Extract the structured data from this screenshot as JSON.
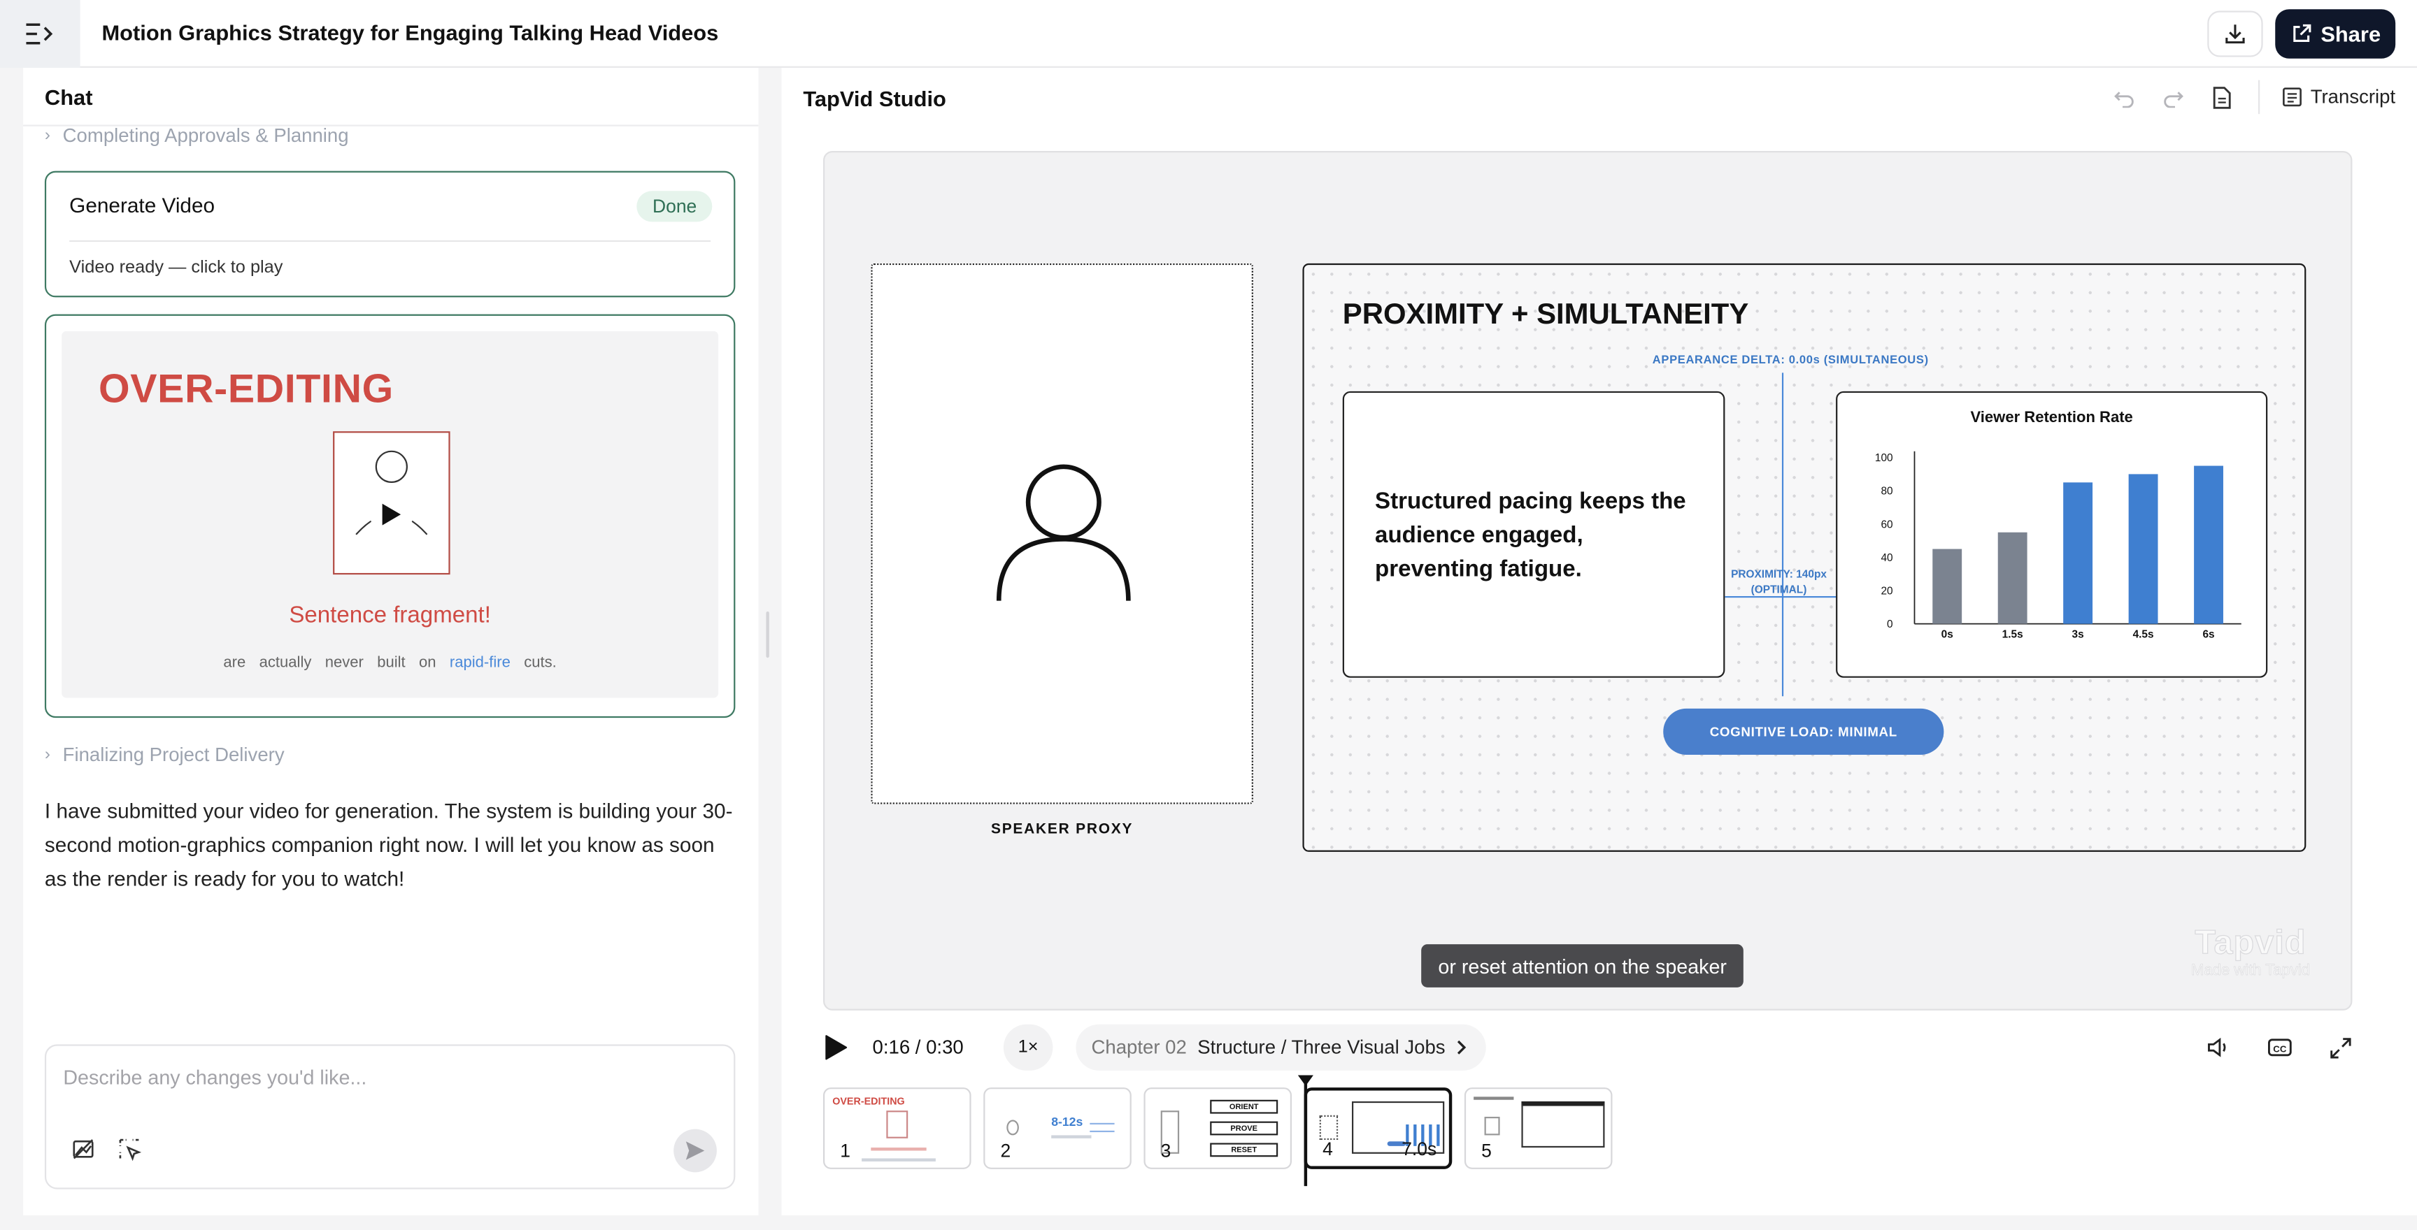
{
  "header": {
    "title": "Motion Graphics Strategy for Engaging Talking Head Videos",
    "share_label": "Share"
  },
  "chat": {
    "title": "Chat",
    "steps": [
      {
        "label": "Completing Approvals & Planning"
      },
      {
        "label": "Finalizing Project Delivery"
      }
    ],
    "generate_card": {
      "title": "Generate Video",
      "status": "Done",
      "subtitle": "Video ready — click to play"
    },
    "preview": {
      "headline": "OVER-EDITING",
      "fragment_label": "Sentence fragment!",
      "words": [
        "are",
        "actually",
        "never",
        "built",
        "on",
        "rapid-fire",
        "cuts."
      ],
      "highlight_word": "rapid-fire"
    },
    "message": "I have submitted your video for generation. The system is building your 30-second motion-graphics companion right now. I will let you know as soon as the render is ready for you to watch!",
    "composer": {
      "placeholder": "Describe any changes you'd like..."
    }
  },
  "studio": {
    "title": "TapVid Studio",
    "transcript_label": "Transcript",
    "speaker_label": "SPEAKER PROXY",
    "slide": {
      "title": "PROXIMITY + SIMULTANEITY",
      "delta_label": "APPEARANCE DELTA: 0.00s (SIMULTANEOUS)",
      "body": "Structured pacing keeps the audience engaged, preventing fatigue.",
      "proximity_line1": "PROXIMITY: 140px",
      "proximity_line2": "(OPTIMAL)",
      "button_label": "COGNITIVE LOAD: MINIMAL"
    },
    "caption": "or reset attention on the speaker",
    "watermark": {
      "logo": "Tapvid",
      "sub": "Made with Tapvid"
    },
    "controls": {
      "time": "0:16 / 0:30",
      "speed": "1×",
      "chapter_num": "Chapter 02",
      "chapter_title": "Structure / Three Visual Jobs"
    },
    "timeline": [
      {
        "num": "1",
        "duration": ""
      },
      {
        "num": "2",
        "duration": ""
      },
      {
        "num": "3",
        "duration": ""
      },
      {
        "num": "4",
        "duration": "7.0s"
      },
      {
        "num": "5",
        "duration": ""
      }
    ],
    "thumb_texts": {
      "t1": "OVER-EDITING",
      "t2": "8-12s",
      "t3a": "ORIENT",
      "t3b": "PROVE",
      "t3c": "RESET"
    }
  },
  "colors": {
    "accent_green": "#3f7a63",
    "accent_red": "#cf4b44",
    "accent_blue": "#4a7fcc",
    "bar_gray": "#7b8390",
    "bar_blue": "#3f7fd0"
  },
  "chart_data": {
    "type": "bar",
    "title": "Viewer Retention Rate",
    "categories": [
      "0s",
      "1.5s",
      "3s",
      "4.5s",
      "6s"
    ],
    "values": [
      45,
      55,
      85,
      90,
      95
    ],
    "ylim": [
      0,
      100
    ],
    "yticks": [
      0,
      20,
      40,
      60,
      80,
      100
    ],
    "bar_colors": [
      "#7b8390",
      "#7b8390",
      "#3f7fd0",
      "#3f7fd0",
      "#3f7fd0"
    ],
    "grid": false
  }
}
